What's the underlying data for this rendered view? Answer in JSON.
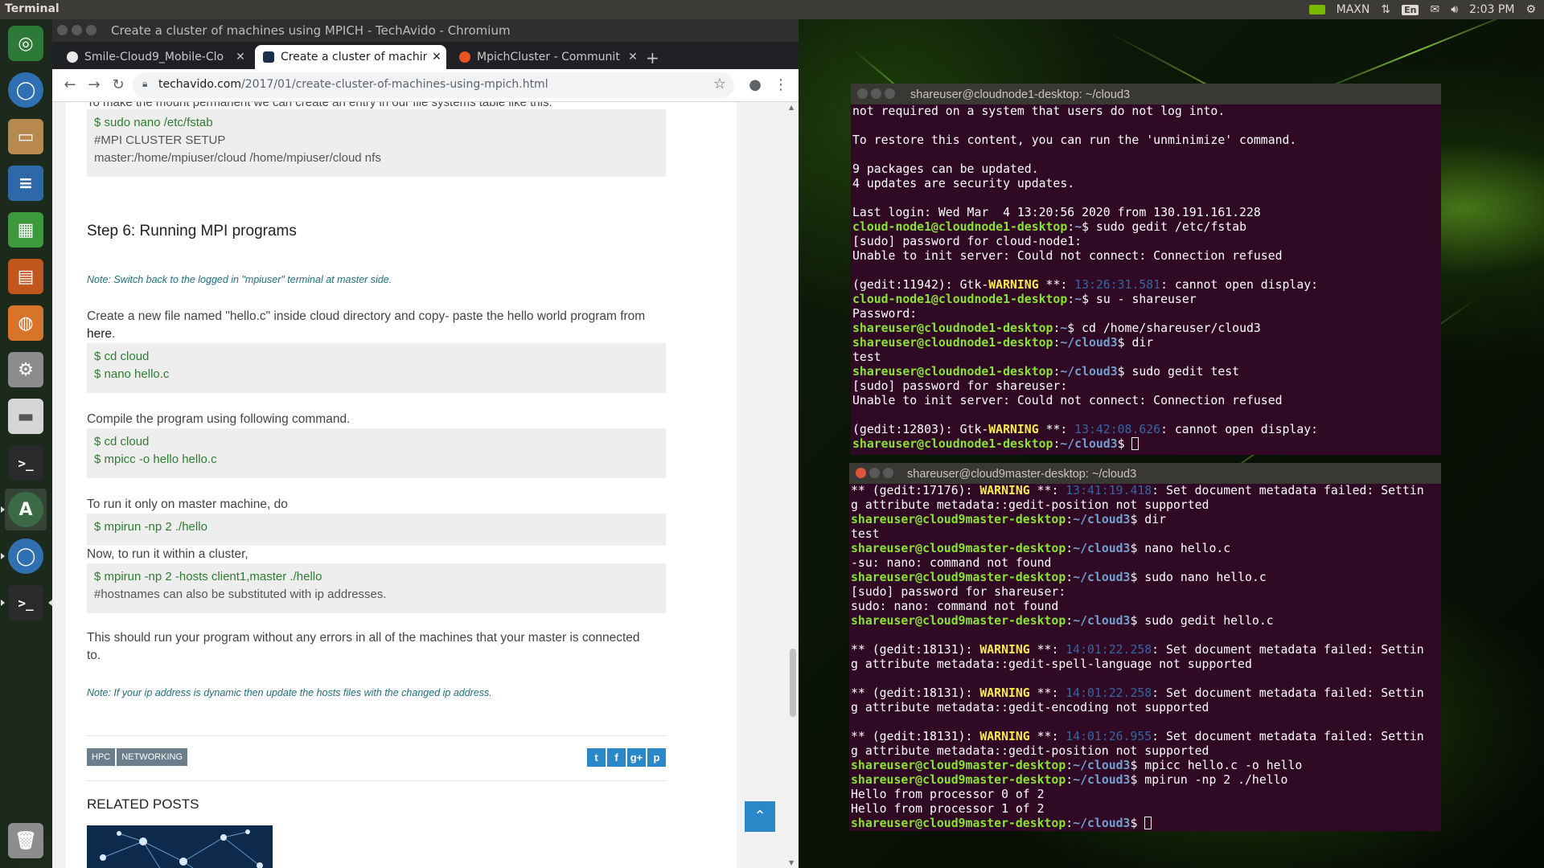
{
  "top_panel": {
    "app_name": "Terminal",
    "tray_maxn": "MAXN",
    "tray_lang": "En",
    "clock": "2:03 PM"
  },
  "launcher": {
    "items": [
      "ubuntu-logo",
      "chromium",
      "files",
      "writer",
      "calc",
      "impress",
      "software-center",
      "system-settings",
      "disk",
      "terminal",
      "software-updater",
      "chromium",
      "terminal"
    ],
    "trash": "trash"
  },
  "chrome": {
    "window_title": "Create a cluster of machines using MPICH - TechAvido - Chromium",
    "tabs": [
      {
        "label": "Smile-Cloud9_Mobile-Clo",
        "active": false
      },
      {
        "label": "Create a cluster of machin",
        "active": true
      },
      {
        "label": "MpichCluster - Communit",
        "active": false
      }
    ],
    "url_host": "techavido.com",
    "url_path": "/2017/01/create-cluster-of-machines-using-mpich.html",
    "cut_line": "To make the mount permanent we can create an entry in our file systems table like this:",
    "fstab_code": [
      "$ sudo nano /etc/fstab",
      "#MPI CLUSTER SETUP",
      "master:/home/mpiuser/cloud /home/mpiuser/cloud nfs"
    ],
    "step_heading": "Step 6: Running MPI programs",
    "note_switch": "Note: Switch back to the logged in \"mpiuser\" terminal at master side.",
    "para_create": "Create a new file named \"hello.c\" inside cloud directory and copy- paste the hello world program from",
    "para_create_link": "here",
    "code_create": [
      "$ cd cloud",
      "$ nano hello.c"
    ],
    "para_compile": "Compile the program using following command.",
    "code_compile": [
      "$ cd cloud",
      "$ mpicc -o hello hello.c"
    ],
    "para_master": "To run it only on master machine, do",
    "code_master": [
      "$ mpirun -np 2 ./hello"
    ],
    "para_cluster": "Now, to run it within a cluster,",
    "code_cluster": [
      "$ mpirun -np 2 -hosts client1,master ./hello",
      "#hostnames can also be substituted with ip addresses."
    ],
    "para_result_1": "This should run your program without any errors in all of the machines that your master is connected",
    "para_result_2": "to.",
    "note_ip": "Note: If your ip address is dynamic then update the hosts files with the changed ip address.",
    "tags": [
      "HPC",
      "NETWORKING"
    ],
    "share_icons": [
      "t",
      "f",
      "g+",
      "p"
    ],
    "related_heading": "RELATED POSTS"
  },
  "terminal_node1": {
    "title": "shareuser@cloudnode1-desktop: ~/cloud3",
    "lines": [
      [
        {
          "t": "not required on a system that users do not log into."
        }
      ],
      [
        {
          "t": ""
        }
      ],
      [
        {
          "t": "To restore this content, you can run the 'unminimize' command."
        }
      ],
      [
        {
          "t": ""
        }
      ],
      [
        {
          "t": "9 packages can be updated."
        }
      ],
      [
        {
          "t": "4 updates are security updates."
        }
      ],
      [
        {
          "t": ""
        }
      ],
      [
        {
          "t": "Last login: Wed Mar  4 13:20:56 2020 from 130.191.161.228"
        }
      ],
      [
        {
          "c": "p",
          "t": "cloud-node1@cloudnode1-desktop"
        },
        {
          "t": ":"
        },
        {
          "c": "b",
          "t": "~"
        },
        {
          "t": "$ sudo gedit /etc/fstab"
        }
      ],
      [
        {
          "t": "[sudo] password for cloud-node1:"
        }
      ],
      [
        {
          "t": "Unable to init server: Could not connect: Connection refused"
        }
      ],
      [
        {
          "t": ""
        }
      ],
      [
        {
          "t": "(gedit:11942): Gtk-"
        },
        {
          "c": "w",
          "t": "WARNING"
        },
        {
          "t": " **: "
        },
        {
          "c": "t",
          "t": "13:26:31.581"
        },
        {
          "t": ": cannot open display:"
        }
      ],
      [
        {
          "c": "p",
          "t": "cloud-node1@cloudnode1-desktop"
        },
        {
          "t": ":"
        },
        {
          "c": "b",
          "t": "~"
        },
        {
          "t": "$ su - shareuser"
        }
      ],
      [
        {
          "t": "Password:"
        }
      ],
      [
        {
          "c": "p",
          "t": "shareuser@cloudnode1-desktop"
        },
        {
          "t": ":"
        },
        {
          "c": "b",
          "t": "~"
        },
        {
          "t": "$ cd /home/shareuser/cloud3"
        }
      ],
      [
        {
          "c": "p",
          "t": "shareuser@cloudnode1-desktop"
        },
        {
          "t": ":"
        },
        {
          "c": "b",
          "t": "~/cloud3"
        },
        {
          "t": "$ dir"
        }
      ],
      [
        {
          "t": "test"
        }
      ],
      [
        {
          "c": "p",
          "t": "shareuser@cloudnode1-desktop"
        },
        {
          "t": ":"
        },
        {
          "c": "b",
          "t": "~/cloud3"
        },
        {
          "t": "$ sudo gedit test"
        }
      ],
      [
        {
          "t": "[sudo] password for shareuser:"
        }
      ],
      [
        {
          "t": "Unable to init server: Could not connect: Connection refused"
        }
      ],
      [
        {
          "t": ""
        }
      ],
      [
        {
          "t": "(gedit:12803): Gtk-"
        },
        {
          "c": "w",
          "t": "WARNING"
        },
        {
          "t": " **: "
        },
        {
          "c": "t",
          "t": "13:42:08.626"
        },
        {
          "t": ": cannot open display:"
        }
      ],
      [
        {
          "c": "p",
          "t": "shareuser@cloudnode1-desktop"
        },
        {
          "t": ":"
        },
        {
          "c": "b",
          "t": "~/cloud3"
        },
        {
          "t": "$ "
        },
        {
          "c": "cur",
          "t": ""
        }
      ]
    ]
  },
  "terminal_master": {
    "title": "shareuser@cloud9master-desktop: ~/cloud3",
    "lines": [
      [
        {
          "t": "** (gedit:17176): "
        },
        {
          "c": "w",
          "t": "WARNING"
        },
        {
          "t": " **: "
        },
        {
          "c": "t",
          "t": "13:41:19.418"
        },
        {
          "t": ": Set document metadata failed: Settin"
        }
      ],
      [
        {
          "t": "g attribute metadata::gedit-position not supported"
        }
      ],
      [
        {
          "c": "p",
          "t": "shareuser@cloud9master-desktop"
        },
        {
          "t": ":"
        },
        {
          "c": "b",
          "t": "~/cloud3"
        },
        {
          "t": "$ dir"
        }
      ],
      [
        {
          "t": "test"
        }
      ],
      [
        {
          "c": "p",
          "t": "shareuser@cloud9master-desktop"
        },
        {
          "t": ":"
        },
        {
          "c": "b",
          "t": "~/cloud3"
        },
        {
          "t": "$ nano hello.c"
        }
      ],
      [
        {
          "t": "-su: nano: command not found"
        }
      ],
      [
        {
          "c": "p",
          "t": "shareuser@cloud9master-desktop"
        },
        {
          "t": ":"
        },
        {
          "c": "b",
          "t": "~/cloud3"
        },
        {
          "t": "$ sudo nano hello.c"
        }
      ],
      [
        {
          "t": "[sudo] password for shareuser:"
        }
      ],
      [
        {
          "t": "sudo: nano: command not found"
        }
      ],
      [
        {
          "c": "p",
          "t": "shareuser@cloud9master-desktop"
        },
        {
          "t": ":"
        },
        {
          "c": "b",
          "t": "~/cloud3"
        },
        {
          "t": "$ sudo gedit hello.c"
        }
      ],
      [
        {
          "t": ""
        }
      ],
      [
        {
          "t": "** (gedit:18131): "
        },
        {
          "c": "w",
          "t": "WARNING"
        },
        {
          "t": " **: "
        },
        {
          "c": "t",
          "t": "14:01:22.258"
        },
        {
          "t": ": Set document metadata failed: Settin"
        }
      ],
      [
        {
          "t": "g attribute metadata::gedit-spell-language not supported"
        }
      ],
      [
        {
          "t": ""
        }
      ],
      [
        {
          "t": "** (gedit:18131): "
        },
        {
          "c": "w",
          "t": "WARNING"
        },
        {
          "t": " **: "
        },
        {
          "c": "t",
          "t": "14:01:22.258"
        },
        {
          "t": ": Set document metadata failed: Settin"
        }
      ],
      [
        {
          "t": "g attribute metadata::gedit-encoding not supported"
        }
      ],
      [
        {
          "t": ""
        }
      ],
      [
        {
          "t": "** (gedit:18131): "
        },
        {
          "c": "w",
          "t": "WARNING"
        },
        {
          "t": " **: "
        },
        {
          "c": "t",
          "t": "14:01:26.955"
        },
        {
          "t": ": Set document metadata failed: Settin"
        }
      ],
      [
        {
          "t": "g attribute metadata::gedit-position not supported"
        }
      ],
      [
        {
          "c": "p",
          "t": "shareuser@cloud9master-desktop"
        },
        {
          "t": ":"
        },
        {
          "c": "b",
          "t": "~/cloud3"
        },
        {
          "t": "$ mpicc hello.c -o hello"
        }
      ],
      [
        {
          "c": "p",
          "t": "shareuser@cloud9master-desktop"
        },
        {
          "t": ":"
        },
        {
          "c": "b",
          "t": "~/cloud3"
        },
        {
          "t": "$ mpirun -np 2 ./hello"
        }
      ],
      [
        {
          "t": "Hello from processor 0 of 2"
        }
      ],
      [
        {
          "t": "Hello from processor 1 of 2"
        }
      ],
      [
        {
          "c": "p",
          "t": "shareuser@cloud9master-desktop"
        },
        {
          "t": ":"
        },
        {
          "c": "b",
          "t": "~/cloud3"
        },
        {
          "t": "$ "
        },
        {
          "c": "cur",
          "t": ""
        }
      ]
    ]
  },
  "colors": {
    "terminal_bg": "#300a24",
    "prompt_green": "#8ae234",
    "path_blue": "#729fcf",
    "warning_yellow": "#fce94f",
    "link_blue": "#2a88c8"
  }
}
